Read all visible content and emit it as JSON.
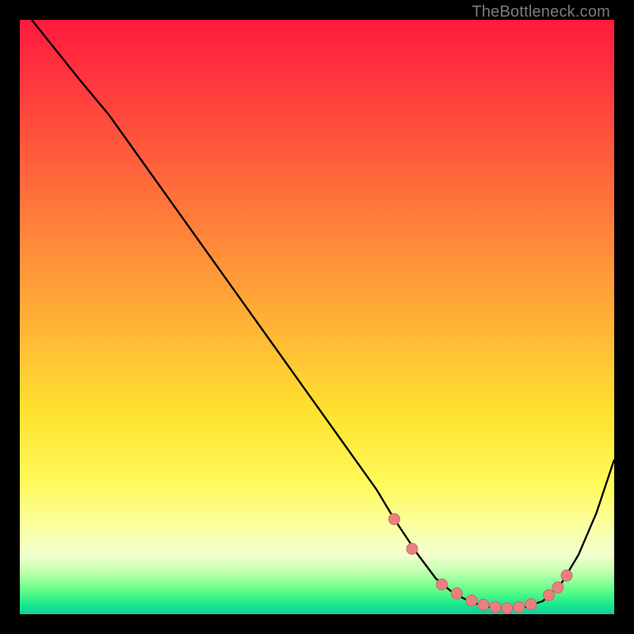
{
  "watermark": {
    "text": "TheBottleneck.com"
  },
  "colors": {
    "line": "#000000",
    "marker_fill": "#e98080",
    "marker_stroke": "#c96a6a"
  },
  "chart_data": {
    "type": "line",
    "title": "",
    "xlabel": "",
    "ylabel": "",
    "xlim": [
      0,
      100
    ],
    "ylim": [
      0,
      100
    ],
    "grid": false,
    "legend": false,
    "series": [
      {
        "name": "bottleneck-curve",
        "x": [
          2,
          6,
          10,
          15,
          20,
          25,
          30,
          35,
          40,
          45,
          50,
          55,
          60,
          63,
          67,
          70,
          73,
          76,
          79,
          82,
          85,
          88,
          91,
          94,
          97,
          100
        ],
        "y": [
          100,
          95,
          90,
          84,
          77,
          70,
          63,
          56,
          49,
          42,
          35,
          28,
          21,
          16,
          10,
          6,
          3.5,
          2,
          1.2,
          1,
          1.2,
          2.2,
          5,
          10,
          17,
          26
        ]
      }
    ],
    "markers": {
      "name": "highlight-dots",
      "x": [
        63,
        66,
        71,
        73.5,
        76,
        78,
        80,
        82,
        84,
        86,
        89,
        90.5,
        92
      ],
      "y": [
        16,
        11,
        5,
        3.5,
        2.3,
        1.6,
        1.2,
        1,
        1.2,
        1.7,
        3.2,
        4.5,
        6.5
      ]
    }
  }
}
